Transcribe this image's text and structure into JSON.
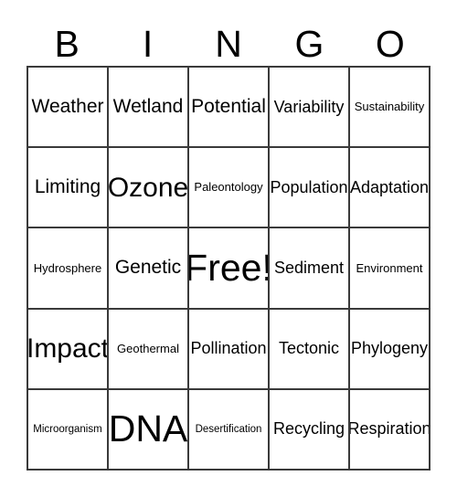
{
  "card": {
    "header_letters": [
      "B",
      "I",
      "N",
      "G",
      "O"
    ],
    "columns": 5,
    "rows": 5,
    "border_color": "#3a3a3a",
    "background_color": "#ffffff",
    "text_color": "#000000",
    "free_space": {
      "row": 2,
      "column": 2,
      "label": "Free!"
    },
    "cells": [
      [
        {
          "label": "Weather",
          "size": "l"
        },
        {
          "label": "Wetland",
          "size": "l"
        },
        {
          "label": "Potential",
          "size": "l"
        },
        {
          "label": "Variability",
          "size": "m"
        },
        {
          "label": "Sustainability",
          "size": "s"
        }
      ],
      [
        {
          "label": "Limiting",
          "size": "l"
        },
        {
          "label": "Ozone",
          "size": "xl"
        },
        {
          "label": "Paleontology",
          "size": "s"
        },
        {
          "label": "Population",
          "size": "m"
        },
        {
          "label": "Adaptation",
          "size": "m"
        }
      ],
      [
        {
          "label": "Hydrosphere",
          "size": "s"
        },
        {
          "label": "Genetic",
          "size": "l"
        },
        {
          "label": "Free!",
          "size": "xxl"
        },
        {
          "label": "Sediment",
          "size": "m"
        },
        {
          "label": "Environment",
          "size": "s"
        }
      ],
      [
        {
          "label": "Impact",
          "size": "xl"
        },
        {
          "label": "Geothermal",
          "size": "s"
        },
        {
          "label": "Pollination",
          "size": "m"
        },
        {
          "label": "Tectonic",
          "size": "m"
        },
        {
          "label": "Phylogeny",
          "size": "m"
        }
      ],
      [
        {
          "label": "Microorganism",
          "size": "xs"
        },
        {
          "label": "DNA",
          "size": "xxl"
        },
        {
          "label": "Desertification",
          "size": "xs"
        },
        {
          "label": "Recycling",
          "size": "m"
        },
        {
          "label": "Respiration",
          "size": "m"
        }
      ]
    ]
  }
}
